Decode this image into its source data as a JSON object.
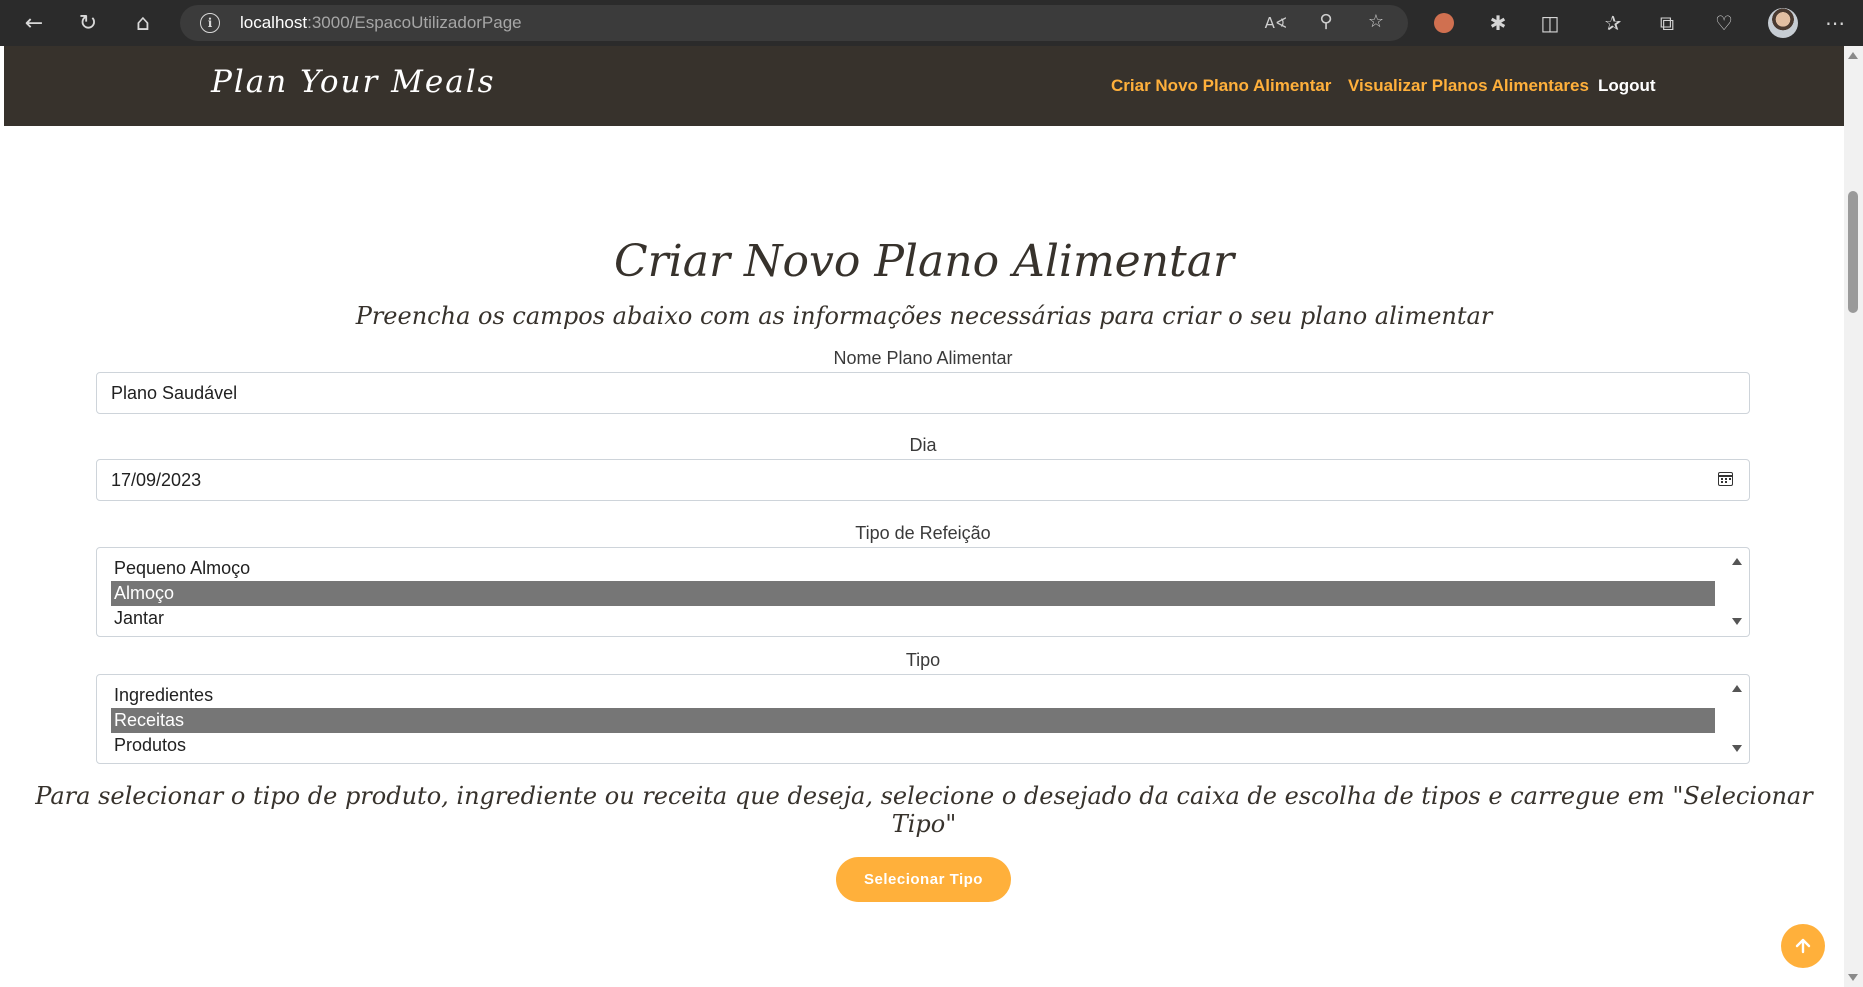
{
  "browser": {
    "url_host": "localhost",
    "url_path": ":3000/EspacoUtilizadorPage",
    "icons": {
      "back": "arrow-left-icon",
      "refresh": "refresh-icon",
      "home": "home-icon",
      "site_info": "info-icon",
      "read_aloud": "read-aloud-icon",
      "zoom": "zoom-out-icon",
      "favorite": "star-icon",
      "extensions": "puzzle-icon",
      "split": "split-screen-icon",
      "favorites": "favorites-icon",
      "collections": "collections-icon",
      "health": "heartbeat-icon",
      "menu": "more-icon"
    }
  },
  "navbar": {
    "brand": "Plan Your Meals",
    "links": {
      "create": "Criar Novo Plano Alimentar",
      "view": "Visualizar Planos Alimentares",
      "logout": "Logout"
    }
  },
  "page": {
    "title": "Criar Novo Plano Alimentar",
    "subtitle": "Preencha os campos abaixo com as informações necessárias para criar o seu plano alimentar"
  },
  "form": {
    "name": {
      "label": "Nome Plano Alimentar",
      "value": "Plano Saudável"
    },
    "day": {
      "label": "Dia",
      "value": "17/09/2023"
    },
    "meal_type": {
      "label": "Tipo de Refeição",
      "options": [
        "Pequeno Almoço",
        "Almoço",
        "Jantar"
      ],
      "selected": "Almoço"
    },
    "type": {
      "label": "Tipo",
      "options": [
        "Ingredientes",
        "Receitas",
        "Produtos"
      ],
      "selected": "Receitas"
    },
    "hint": "Para selecionar o tipo de produto, ingrediente ou receita que deseja, selecione o desejado da caixa de escolha de tipos e carregue em \"Selecionar Tipo\"",
    "select_button": "Selecionar Tipo"
  },
  "colors": {
    "accent": "#ffb03b",
    "navbar_bg": "#37322c",
    "selected_option": "#767676"
  }
}
